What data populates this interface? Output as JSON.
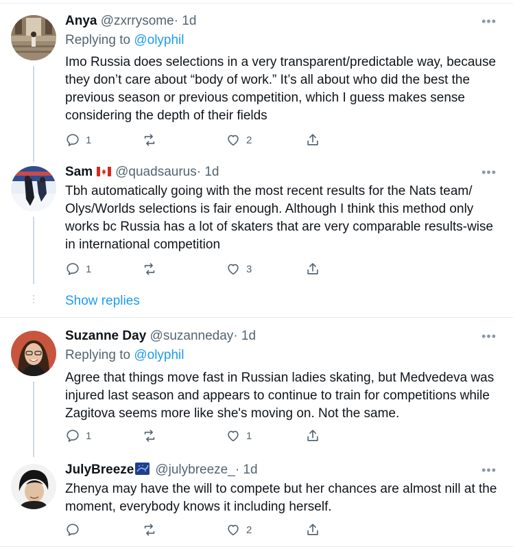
{
  "tweets": [
    {
      "name": "Anya",
      "handle": "@zxrrysome",
      "time": "· 1d",
      "replying_prefix": "Replying to",
      "replying_to": "@olyphil",
      "text": "Imo Russia does selections in a very transparent/predictable way, because they don’t care about “body of work.” It’s all about who did the best the previous season or previous competition, which I guess makes sense considering the depth of their fields",
      "replies": "1",
      "retweets": "",
      "likes": "2"
    },
    {
      "name": "Sam",
      "flag": "canada-flag",
      "handle": "@quadsaurus",
      "time": "· 1d",
      "text": "Tbh automatically going with the most recent results for the Nats team/ Olys/Worlds selections is fair enough. Although I think this method only works bc Russia has a lot of skaters that are very comparable results-wise in international competition",
      "replies": "1",
      "retweets": "",
      "likes": "3"
    },
    {
      "name": "Suzanne Day",
      "handle": "@suzanneday",
      "time": "· 1d",
      "replying_prefix": "Replying to",
      "replying_to": "@olyphil",
      "text": "Agree that things move fast in Russian ladies skating, but Medvedeva was injured last season and appears to continue to train for competitions while Zagitova seems more like she's moving on. Not the same.",
      "replies": "1",
      "retweets": "",
      "likes": "1"
    },
    {
      "name": "JulyBreeze",
      "handle": "@julybreeze_",
      "time": "· 1d",
      "text": "Zhenya may have the will to compete but her chances are almost  nill at the moment, everybody knows it including herself.",
      "replies": "",
      "retweets": "",
      "likes": "2"
    }
  ],
  "show_replies": "Show replies",
  "more_glyph": "•••",
  "colors": {
    "accent": "#1d9bf0",
    "text": "#0f1419",
    "muted": "#536471",
    "line": "#cfd9de"
  }
}
